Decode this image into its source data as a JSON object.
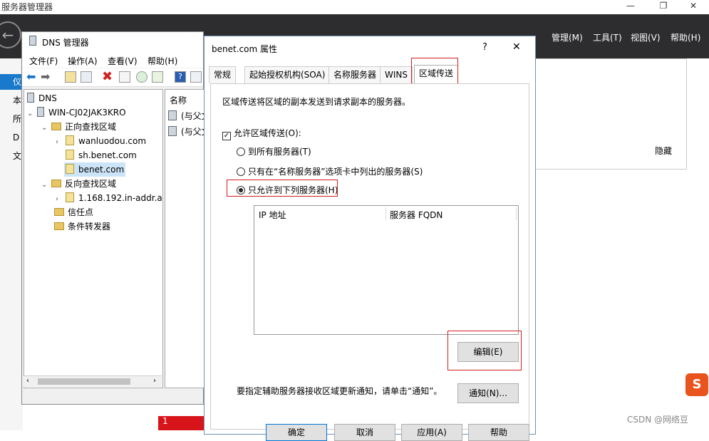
{
  "sm": {
    "title": "服务器管理器",
    "menu": [
      "管理(M)",
      "工具(T)",
      "视图(V)",
      "帮助(H)"
    ],
    "header_partial": "服务器管理器 · 仪表板",
    "left_items": [
      "仪",
      "本",
      "所",
      "D",
      "文"
    ],
    "right_hide": "隐藏",
    "bottom_number": "1"
  },
  "dns": {
    "title": "DNS 管理器",
    "menu": [
      "文件(F)",
      "操作(A)",
      "查看(V)",
      "帮助(H)"
    ],
    "tree": {
      "root": "DNS",
      "server": "WIN-CJ02JAK3KRO",
      "forward": "正向查找区域",
      "zones": [
        "wanluodou.com",
        "sh.benet.com",
        "benet.com"
      ],
      "reverse": "反向查找区域",
      "reverse_zone": "1.168.192.in-addr.a",
      "trust": "信任点",
      "forwarders": "条件转发器"
    },
    "list_header": "名称",
    "list_items": [
      "(与父文",
      "(与父文"
    ]
  },
  "dlg": {
    "title": "benet.com 属性",
    "help": "?",
    "close": "✕",
    "tabs": [
      "常规",
      "起始授权机构(SOA)",
      "名称服务器",
      "WINS",
      "区域传送"
    ],
    "description": "区域传送将区域的副本发送到请求副本的服务器。",
    "allow_label": "允许区域传送(O):",
    "allow_checked": true,
    "radio_all": "到所有服务器(T)",
    "radio_ns": "只有在“名称服务器”选项卡中列出的服务器(S)",
    "radio_listed": "只允许到下列服务器(H)",
    "selected_radio": "radio_listed",
    "col_ip": "IP 地址",
    "col_fqdn": "服务器 FQDN",
    "edit_button": "编辑(E)",
    "notify_text": "要指定辅助服务器接收区域更新通知，请单击“通知”。",
    "notify_button": "通知(N)...",
    "footer_buttons": [
      "确定",
      "取消",
      "应用(A)",
      "帮助"
    ]
  },
  "watermark": "CSDN @网络豆",
  "colors": {
    "accent_red": "#d21f1f",
    "header_dark": "#2d2d30"
  }
}
